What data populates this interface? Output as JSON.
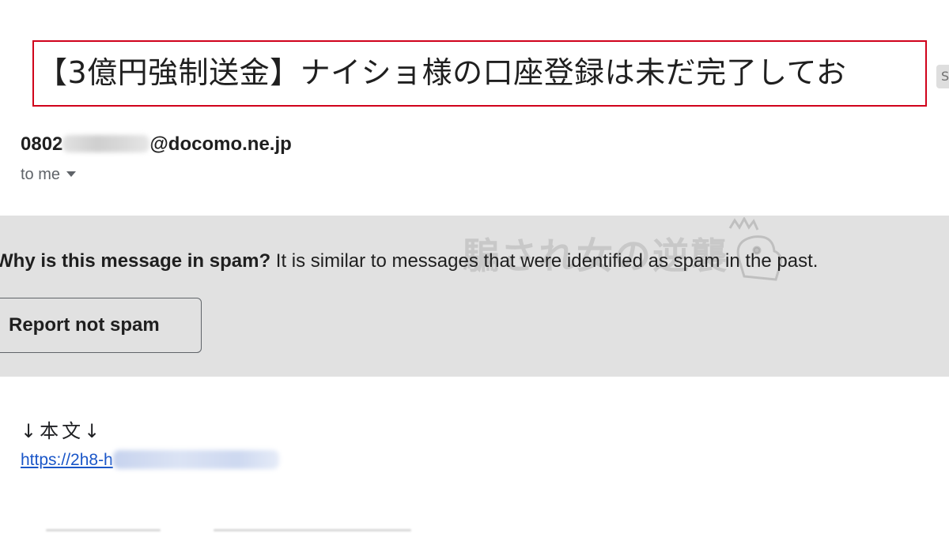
{
  "email": {
    "subject": "【3億円強制送金】ナイショ様の口座登録は未だ完了してお",
    "label_chip": "S",
    "sender": {
      "prefix": "0802",
      "domain": "@docomo.ne.jp"
    },
    "recipient_label": "to me"
  },
  "spam_notice": {
    "question": "Why is this message in spam?",
    "explanation": " It is similar to messages that were identified as spam in the past.",
    "report_button_label": "Report not spam",
    "watermark_text": "騙され女の逆襲"
  },
  "message_body": {
    "heading": "↓本文↓",
    "link_text": "https://2h8-h"
  },
  "colors": {
    "highlight_border": "#d0021b",
    "spam_panel_bg": "#e1e1e1",
    "link": "#1a56c8"
  },
  "icons": {
    "recipient_dropdown": "caret-down-icon",
    "watermark_logo": "watermark-mascot-icon"
  }
}
